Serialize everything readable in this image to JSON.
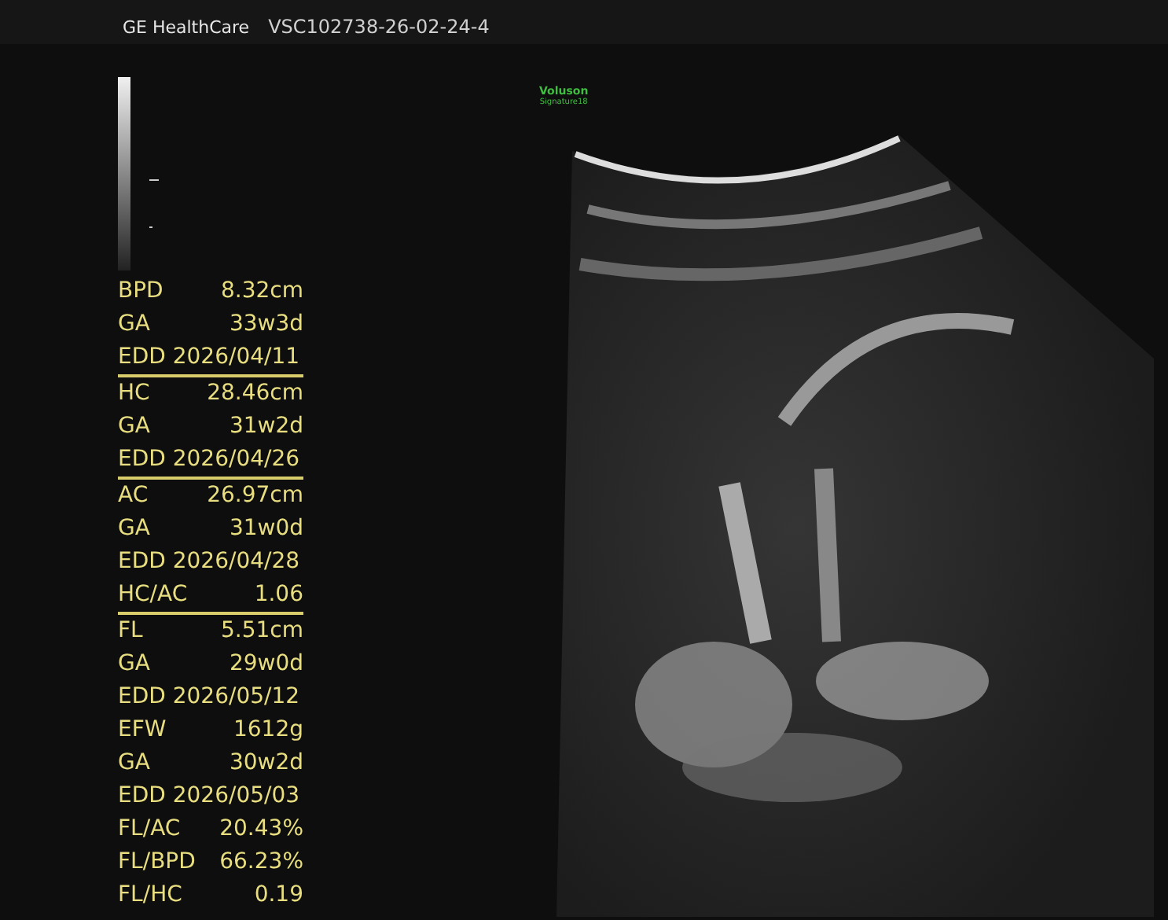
{
  "header": {
    "brand": "GE HealthCare",
    "exam_id": "VSC102738-26-02-24-4"
  },
  "device_logo": {
    "line_1": "Voluson",
    "line_2": "Signature18"
  },
  "measurements": [
    {
      "rows": [
        {
          "kind": "pair",
          "label": "BPD",
          "value": "8.32cm"
        },
        {
          "kind": "pair",
          "label": "GA",
          "value": "33w3d"
        },
        {
          "kind": "full",
          "text": "EDD 2026/04/11"
        }
      ]
    },
    {
      "rows": [
        {
          "kind": "pair",
          "label": "HC",
          "value": "28.46cm"
        },
        {
          "kind": "pair",
          "label": "GA",
          "value": "31w2d"
        },
        {
          "kind": "full",
          "text": "EDD 2026/04/26"
        }
      ]
    },
    {
      "rows": [
        {
          "kind": "pair",
          "label": "AC",
          "value": "26.97cm"
        },
        {
          "kind": "pair",
          "label": "GA",
          "value": "31w0d"
        },
        {
          "kind": "full",
          "text": "EDD 2026/04/28"
        },
        {
          "kind": "pair",
          "label": "HC/AC",
          "value": "1.06"
        }
      ]
    },
    {
      "rows": [
        {
          "kind": "pair",
          "label": "FL",
          "value": "5.51cm"
        },
        {
          "kind": "pair",
          "label": "GA",
          "value": "29w0d"
        },
        {
          "kind": "full",
          "text": "EDD 2026/05/12"
        },
        {
          "kind": "pair",
          "label": "EFW",
          "value": "1612g"
        },
        {
          "kind": "pair",
          "label": "GA",
          "value": "30w2d"
        },
        {
          "kind": "full",
          "text": "EDD 2026/05/03"
        },
        {
          "kind": "pair",
          "label": "FL/AC",
          "value": "20.43%"
        },
        {
          "kind": "pair",
          "label": "FL/BPD",
          "value": "66.23%"
        },
        {
          "kind": "pair",
          "label": "FL/HC",
          "value": "0.19"
        }
      ]
    }
  ]
}
